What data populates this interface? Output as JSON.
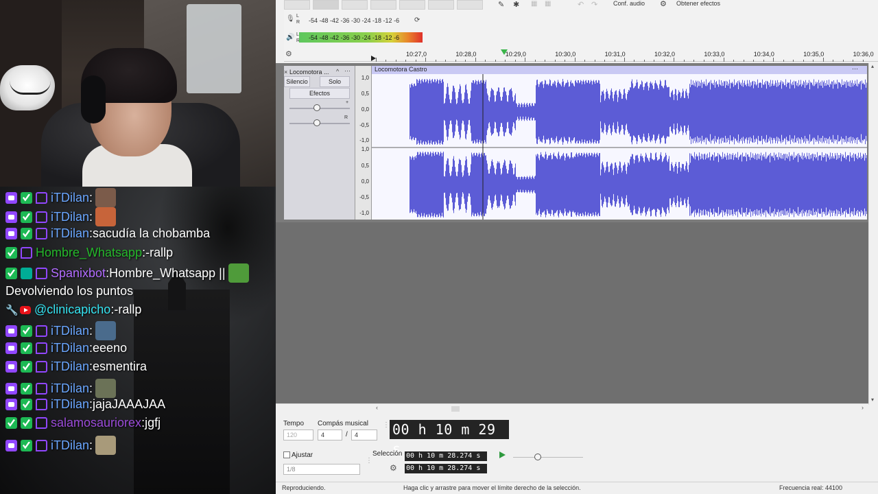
{
  "chat": {
    "messages": [
      {
        "badges": [
          "sub",
          "vip",
          "twitch"
        ],
        "user": "iTDilan",
        "user_color": "#6aa6ff",
        "text": "",
        "emote": "#7b5b4a"
      },
      {
        "badges": [
          "sub",
          "vip",
          "twitch"
        ],
        "user": "iTDilan",
        "user_color": "#6aa6ff",
        "text": "",
        "emote": "#c7643a"
      },
      {
        "badges": [
          "sub",
          "vip",
          "twitch"
        ],
        "user": "iTDilan",
        "user_color": "#6aa6ff",
        "text": "sacudía la chobamba",
        "emote": ""
      },
      {
        "badges": [
          "vip",
          "twitch"
        ],
        "user": "Hombre_Whatsapp",
        "user_color": "#25b82b",
        "text": "-rallp",
        "emote": ""
      },
      {
        "badges": [
          "vip",
          "bot",
          "twitch"
        ],
        "user": "Spanixbot",
        "user_color": "#b26cff",
        "text": "Hombre_Whatsapp ||",
        "emote": "#4f9b3a"
      },
      {
        "badges": [],
        "user": "",
        "user_color": "#ffffff",
        "text": "Devolviendo los puntos",
        "emote": ""
      },
      {
        "badges": [
          "wrench",
          "yt"
        ],
        "user": "@clinicapicho",
        "user_color": "#35e4f2",
        "text": "-rallp",
        "emote": ""
      },
      {
        "badges": [
          "sub",
          "vip",
          "twitch"
        ],
        "user": "iTDilan",
        "user_color": "#6aa6ff",
        "text": "",
        "emote": "#4a6b8c"
      },
      {
        "badges": [
          "sub",
          "vip",
          "twitch"
        ],
        "user": "iTDilan",
        "user_color": "#6aa6ff",
        "text": "eeeno",
        "emote": ""
      },
      {
        "badges": [
          "sub",
          "vip",
          "twitch"
        ],
        "user": "iTDilan",
        "user_color": "#6aa6ff",
        "text": "esmentira",
        "emote": ""
      },
      {
        "badges": [
          "sub",
          "vip",
          "twitch"
        ],
        "user": "iTDilan",
        "user_color": "#6aa6ff",
        "text": "",
        "emote": "#6b7257"
      },
      {
        "badges": [
          "sub",
          "vip",
          "twitch"
        ],
        "user": "iTDilan",
        "user_color": "#6aa6ff",
        "text": "jajaJAAAJAA",
        "emote": ""
      },
      {
        "badges": [
          "vip",
          "vip",
          "twitch"
        ],
        "user": "salamosauriorex",
        "user_color": "#9b4bd9",
        "text": "jgfj",
        "emote": ""
      },
      {
        "badges": [
          "sub",
          "vip",
          "twitch"
        ],
        "user": "iTDilan",
        "user_color": "#6aa6ff",
        "text": "",
        "emote": "#a89a7a"
      }
    ]
  },
  "audacity": {
    "toolbar": {
      "audio_setup": "Conf. audio",
      "get_effects": "Obtener efectos"
    },
    "meters": {
      "record_scale": "-54  -48  -42  -36  -30  -24  -18  -12   -6",
      "play_scale": "-54  -48  -42  -36  -30  -24  -18  -12   -6",
      "record_channels": [
        "L",
        "R"
      ],
      "play_channels": [
        "L",
        "R"
      ]
    },
    "ruler": {
      "ticks": [
        "10:27,0",
        "10:28,0",
        "10:29,0",
        "10:30,0",
        "10:31,0",
        "10:32,0",
        "10:33,0",
        "10:34,0",
        "10:35,0",
        "10:36,0"
      ]
    },
    "track": {
      "name": "Locomotora ...",
      "clip_name": "Locomotora Castro",
      "mute": "Silencio",
      "solo": "Solo",
      "effects": "Efectos",
      "pan_right": "R",
      "scale_top": [
        "1,0",
        "0,5",
        "0,0",
        "-0,5",
        "-1,0"
      ],
      "scale_bottom": [
        "1,0",
        "0,5",
        "0,0",
        "-0,5",
        "-1,0"
      ],
      "wave_color": "#5c5cd6"
    },
    "bottom": {
      "tempo_label": "Tempo",
      "tempo_value": "120",
      "time_sig_label": "Compás musical",
      "time_sig_num": "4",
      "time_sig_sep": "/",
      "time_sig_den": "4",
      "time_display": "00 h 10 m 29 s",
      "snap_label": "Ajustar",
      "snap_value": "1/8",
      "selection_label": "Selección",
      "selection_start": "00 h 10 m 28.274 s",
      "selection_end": "00 h 10 m 28.274 s"
    },
    "status": {
      "state": "Reproduciendo.",
      "hint": "Haga clic y arrastre para mover el límite derecho de la selección.",
      "rate": "Frecuencia real: 44100"
    }
  }
}
